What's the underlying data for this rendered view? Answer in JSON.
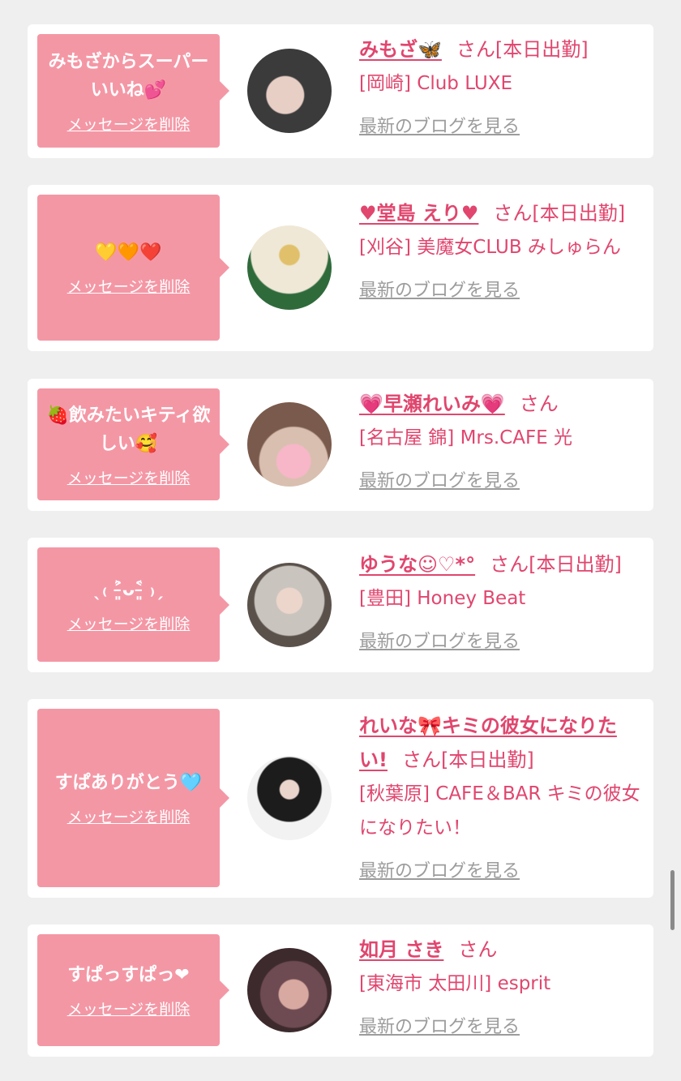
{
  "items": [
    {
      "message": "みもざからスーパーいいね💕",
      "delete_label": "メッセージを削除",
      "name": "みもざ🦋",
      "san": "さん",
      "status": "[本日出勤]",
      "shop": "[岡崎] Club LUXE",
      "blog_label": "最新のブログを見る",
      "avatar_colors": [
        "#3b3b3b",
        "#e8cfc6"
      ]
    },
    {
      "message": "💛🧡❤️",
      "delete_label": "メッセージを削除",
      "name": "♥堂島 えり♥",
      "san": "さん",
      "status": "[本日出勤]",
      "shop": "[刈谷] 美魔女CLUB みしゅらん",
      "blog_label": "最新のブログを見る",
      "avatar_colors": [
        "#efe8d6",
        "#2f6a3b"
      ]
    },
    {
      "message": "🍓飲みたいキティ欲しい🥰",
      "delete_label": "メッセージを削除",
      "name": "💗早瀬れいみ💗",
      "san": "さん",
      "status": "",
      "shop": "[名古屋 錦] Mrs.CAFE 光",
      "blog_label": "最新のブログを見る",
      "avatar_colors": [
        "#7a5a4c",
        "#f7b7c8"
      ]
    },
    {
      "message": "ˎ₍ ˃̵͈̑ᴗ˂̵͈̑ ₎ˏ",
      "delete_label": "メッセージを削除",
      "name": "ゆうな☺︎♡*°",
      "san": "さん",
      "status": "[本日出勤]",
      "shop": "[豊田] Honey Beat",
      "blog_label": "最新のブログを見る",
      "avatar_colors": [
        "#c9c4be",
        "#5a514b"
      ]
    },
    {
      "message": "すぱありがとう🩵",
      "delete_label": "メッセージを削除",
      "name": "れいな🎀キミの彼女になりたい!",
      "san": "さん",
      "status": "[本日出勤]",
      "shop": "[秋葉原] CAFE＆BAR キミの彼女になりたい！",
      "blog_label": "最新のブログを見る",
      "avatar_colors": [
        "#f2f2f2",
        "#1c1c1c"
      ]
    },
    {
      "message": "すぱっすぱっ❤",
      "delete_label": "メッセージを削除",
      "name": "如月 さき",
      "san": "さん",
      "status": "",
      "shop": "[東海市 太田川] esprit",
      "blog_label": "最新のブログを見る",
      "avatar_colors": [
        "#3d2a2d",
        "#d8a9a0"
      ]
    }
  ],
  "colors": {
    "accent": "#e0466e",
    "bubble": "#f497a5",
    "card": "#ffffff",
    "background": "#efefef",
    "link_gray": "#9c9c9c"
  }
}
